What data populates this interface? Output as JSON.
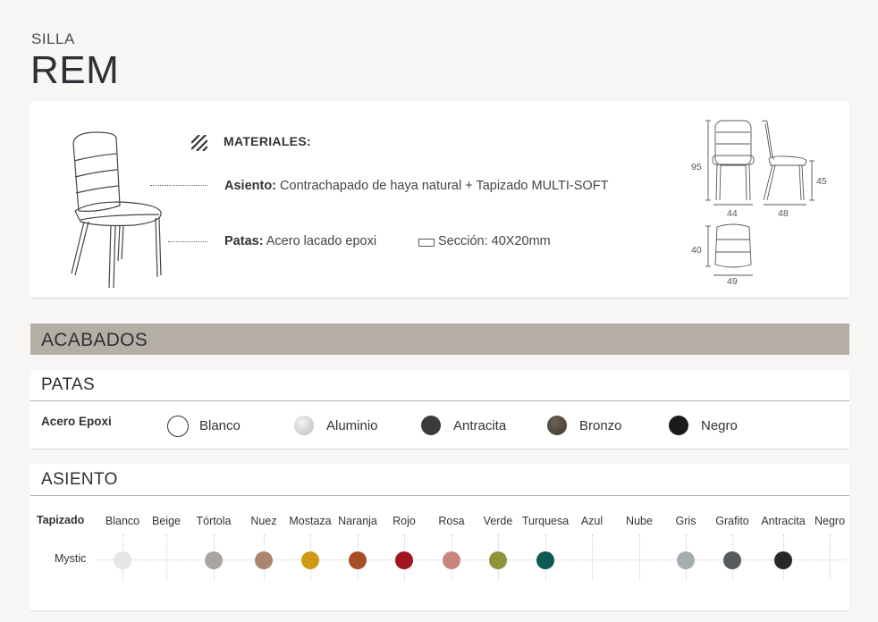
{
  "header": {
    "kind": "SILLA",
    "model": "REM"
  },
  "materials": {
    "heading": "MATERIALES:",
    "seat_label": "Asiento:",
    "seat_text": " Contrachapado de haya natural + Tapizado MULTI-SOFT",
    "legs_label": "Patas:",
    "legs_text": " Acero lacado epoxi",
    "section_text": "Sección:  40X20mm"
  },
  "dimensions": {
    "height": "95",
    "width_front": "44",
    "depth_side": "48",
    "seat_height": "45",
    "top_depth": "40",
    "top_width": "49"
  },
  "finishes": {
    "title": "ACABADOS",
    "legs": {
      "title": "PATAS",
      "row_label": "Acero Epoxi",
      "options": [
        {
          "name": "Blanco",
          "color": "#ffffff"
        },
        {
          "name": "Aluminio",
          "color": "#d6d6d8"
        },
        {
          "name": "Antracita",
          "color": "#3a3b3d"
        },
        {
          "name": "Bronzo",
          "color": "#4c463c"
        },
        {
          "name": "Negro",
          "color": "#1b1b1d"
        }
      ]
    },
    "seat": {
      "title": "ASIENTO",
      "header_label": "Tapizado",
      "row_label": "Mystic",
      "columns": [
        {
          "name": "Blanco",
          "color": "#e6e6e6",
          "available": true
        },
        {
          "name": "Beige",
          "color": "",
          "available": false
        },
        {
          "name": "Tórtola",
          "color": "#aca49e",
          "available": true
        },
        {
          "name": "Nuez",
          "color": "#ab8570",
          "available": true
        },
        {
          "name": "Mostaza",
          "color": "#d19a14",
          "available": true
        },
        {
          "name": "Naranja",
          "color": "#a94e26",
          "available": true
        },
        {
          "name": "Rojo",
          "color": "#a0151e",
          "available": true
        },
        {
          "name": "Rosa",
          "color": "#c8857d",
          "available": true
        },
        {
          "name": "Verde",
          "color": "#8e9239",
          "available": true
        },
        {
          "name": "Turquesa",
          "color": "#0d5a55",
          "available": true
        },
        {
          "name": "Azul",
          "color": "",
          "available": false
        },
        {
          "name": "Nube",
          "color": "",
          "available": false
        },
        {
          "name": "Gris",
          "color": "#a6adb1",
          "available": true
        },
        {
          "name": "Grafito",
          "color": "#575b60",
          "available": true
        },
        {
          "name": "Antracita",
          "color": "#26272b",
          "available": true
        },
        {
          "name": "Negro",
          "color": "",
          "available": false
        }
      ]
    }
  }
}
